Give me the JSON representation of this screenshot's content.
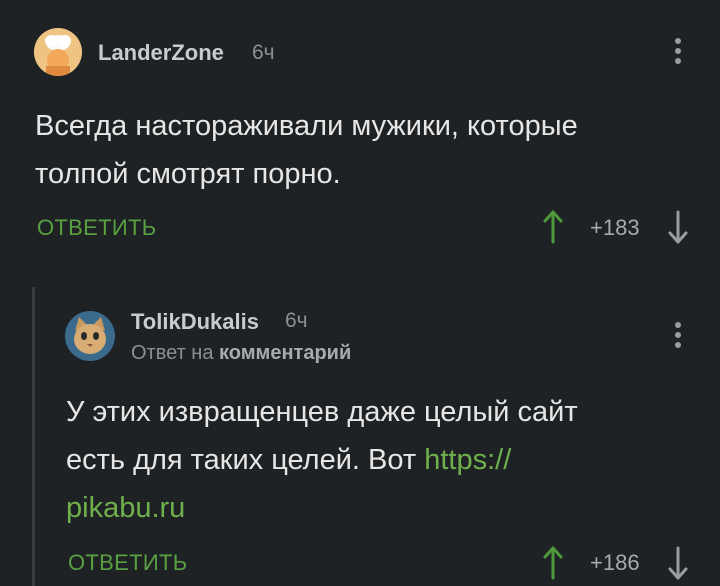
{
  "comments": [
    {
      "username": "LanderZone",
      "time": "6ч",
      "text_lines": [
        "Всегда настораживали мужики, которые",
        "толпой смотрят порно."
      ],
      "reply_label": "ОТВЕТИТЬ",
      "rating": "+183",
      "avatar_icon": "chef-avatar-icon"
    },
    {
      "username": "TolikDukalis",
      "time": "6ч",
      "reply_prefix": "Ответ на",
      "reply_target": "комментарий",
      "text_lines": [
        "У этих извращенцев даже целый сайт",
        "есть для таких целей. Вот "
      ],
      "link_part1": "https://",
      "link_part2": "pikabu.ru",
      "reply_label": "ОТВЕТИТЬ",
      "rating": "+186",
      "avatar_icon": "cat-avatar-icon"
    }
  ],
  "colors": {
    "background": "#1f2224",
    "accent_green": "#58a040",
    "link_green": "#6fb04c",
    "upvote_green": "#4c9a3a"
  }
}
